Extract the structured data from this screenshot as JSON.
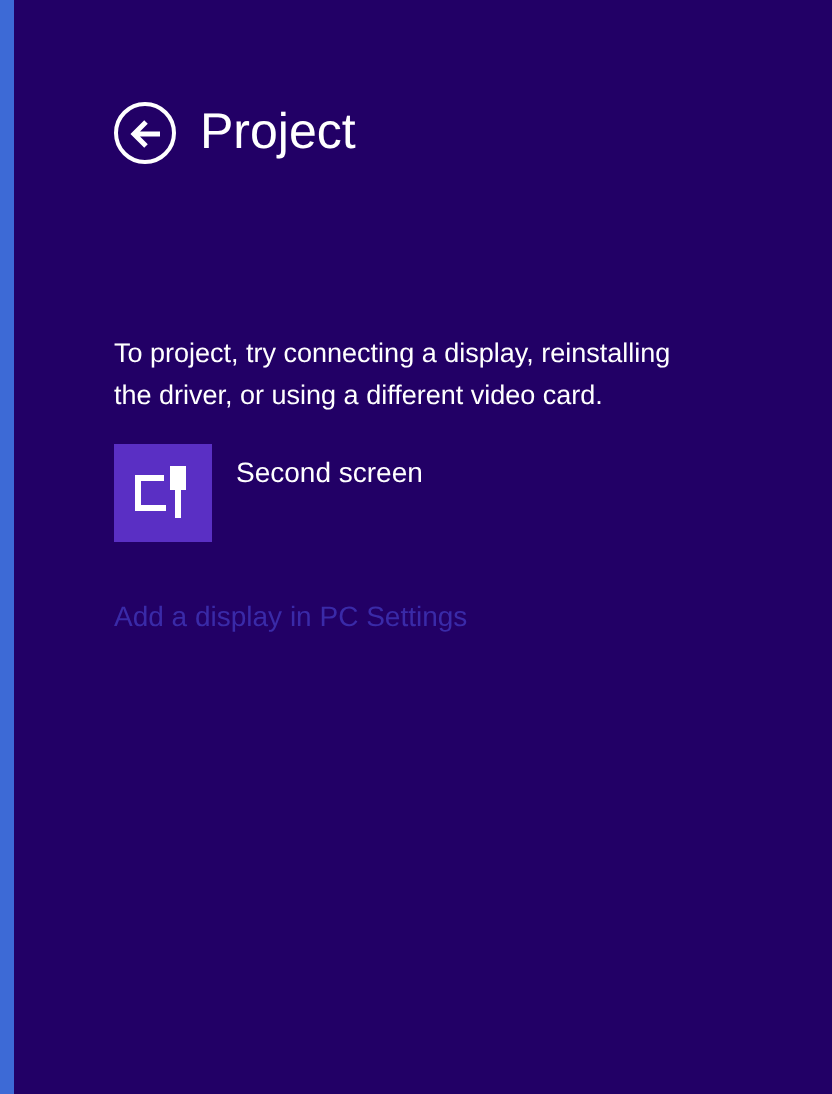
{
  "header": {
    "title": "Project"
  },
  "message": "To project, try connecting a display, reinstalling the driver, or using a different video card.",
  "options": [
    {
      "label": "Second screen"
    }
  ],
  "link": {
    "label": "Add a display in PC Settings",
    "disabled": true
  }
}
